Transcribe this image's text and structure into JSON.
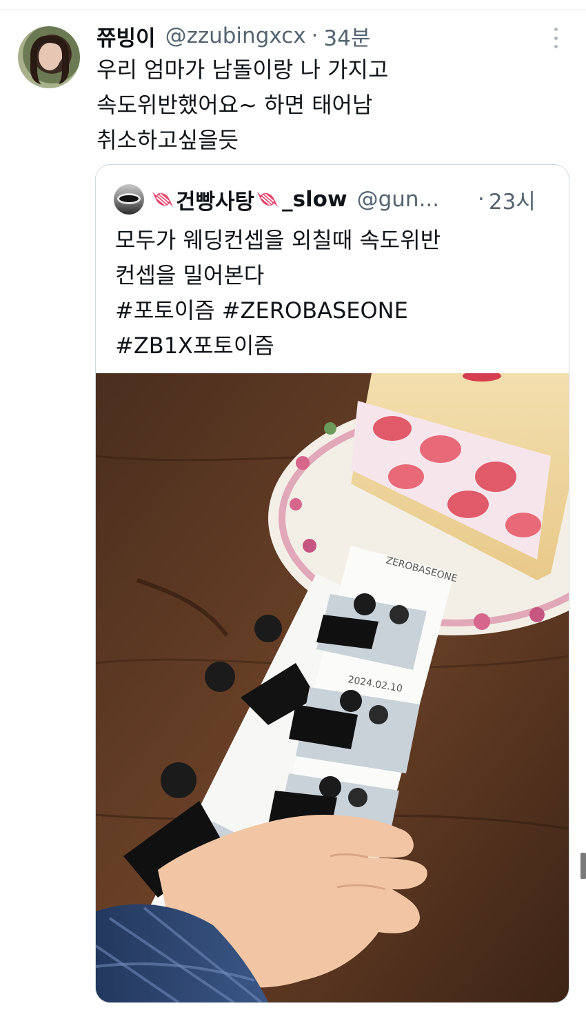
{
  "tweet": {
    "display_name": "쮸빙이",
    "handle": "@zzubingxcx",
    "separator": "·",
    "time": "34분",
    "text_lines": [
      "우리 엄마가 남돌이랑 나 가지고",
      "속도위반했어요~ 하면 태어남",
      "취소하고싶을듯"
    ]
  },
  "quote": {
    "display_name": "건빵사탕",
    "name_suffix": "_slow",
    "handle": "@gun...",
    "separator": "·",
    "time": "23시",
    "name_icons": [
      "candy-icon",
      "candy-icon"
    ],
    "text_lines": [
      "모두가 웨딩컨셉을 외칠때 속도위반",
      "컨셉을 밀어본다",
      "#포토이즘 #ZEROBASEONE",
      "#ZB1X포토이즘"
    ],
    "photo_strip_date": "2024.02.10",
    "photo_strip_brand": "ZEROBASEONE"
  },
  "icons": {
    "more": "more-vertical-icon"
  },
  "colors": {
    "text_primary": "#0f1419",
    "text_secondary": "#536471",
    "border": "#cfd9de"
  }
}
